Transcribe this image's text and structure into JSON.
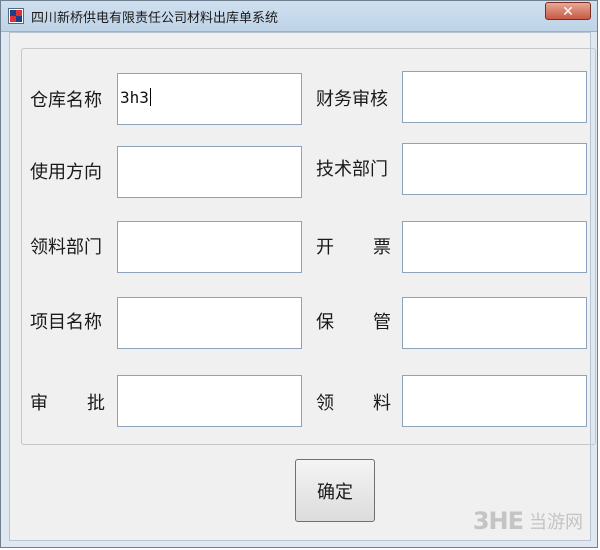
{
  "window": {
    "title": "四川新桥供电有限责任公司材料出库单系统",
    "close_label": "✕"
  },
  "form": {
    "left": [
      {
        "label": "仓库名称",
        "value": "3h3"
      },
      {
        "label": "使用方向",
        "value": ""
      },
      {
        "label": "领料部门",
        "value": ""
      },
      {
        "label": "项目名称",
        "value": ""
      },
      {
        "label": [
          "审",
          "批"
        ],
        "value": ""
      }
    ],
    "right": [
      {
        "label": "财务审核",
        "value": ""
      },
      {
        "label": "技术部门",
        "value": ""
      },
      {
        "label": [
          "开",
          "票"
        ],
        "value": ""
      },
      {
        "label": [
          "保",
          "管"
        ],
        "value": ""
      },
      {
        "label": [
          "领",
          "料"
        ],
        "value": ""
      }
    ]
  },
  "buttons": {
    "ok": "确定"
  },
  "watermark": {
    "logo": "3HE",
    "text": "当游网"
  }
}
